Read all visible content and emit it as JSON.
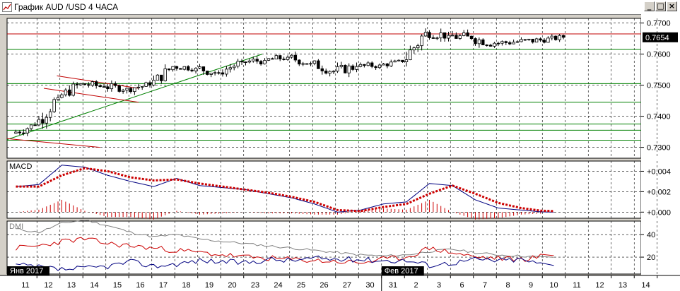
{
  "window": {
    "title": "График AUD /USD  4 ЧАСА",
    "minimize_label": "_",
    "maximize_label": "□",
    "close_label": "×"
  },
  "colors": {
    "background": "#ffffff",
    "grid": "#000000",
    "candle": "#000000",
    "resistance_line": "#c00000",
    "support_lines": "#008000",
    "trend_line": "#008000",
    "macd_line": "#000080",
    "signal_line": "#cc0000",
    "histogram": "#cc0000",
    "adx": "#808080",
    "di_plus": "#cc0000",
    "di_minus": "#000080",
    "price_label_bg": "#000000",
    "price_label_fg": "#ffffff"
  },
  "chart_data": {
    "type": "candlestick",
    "symbol": "AUD/USD",
    "timeframe": "4 ЧАСА",
    "current_price": "0.7654",
    "price_axis_ticks": [
      "0.7700",
      "0.7600",
      "0.7500",
      "0.7400",
      "0.7300"
    ],
    "price_ylim": [
      0.7265,
      0.7715
    ],
    "horizontal_levels": {
      "resistance": [
        0.7665
      ],
      "support": [
        0.7615,
        0.7505,
        0.7445,
        0.7375,
        0.7355,
        0.7323
      ]
    },
    "date_labels": [
      "11",
      "12",
      "13",
      "14",
      "15",
      "16",
      "17",
      "18",
      "19",
      "20",
      "23",
      "24",
      "25",
      "26",
      "27",
      "30",
      "31",
      "2",
      "3",
      "6",
      "7",
      "8",
      "9",
      "10",
      "11",
      "12",
      "13",
      "14"
    ],
    "month_labels": [
      {
        "text": "Янв 2017",
        "date_index": 0
      },
      {
        "text": "Фев 2017",
        "date_index": 16
      }
    ],
    "candles_per_day": 6,
    "daily_ohlc": [
      [
        0.7345,
        0.7385,
        0.732,
        0.7372
      ],
      [
        0.7372,
        0.7475,
        0.736,
        0.746
      ],
      [
        0.746,
        0.753,
        0.745,
        0.7505
      ],
      [
        0.7505,
        0.7525,
        0.747,
        0.7495
      ],
      [
        0.7495,
        0.752,
        0.7465,
        0.749
      ],
      [
        0.749,
        0.7515,
        0.746,
        0.75
      ],
      [
        0.75,
        0.7575,
        0.749,
        0.756
      ],
      [
        0.756,
        0.758,
        0.7535,
        0.7555
      ],
      [
        0.7555,
        0.757,
        0.75,
        0.754
      ],
      [
        0.754,
        0.7585,
        0.7525,
        0.7575
      ],
      [
        0.7575,
        0.7595,
        0.754,
        0.758
      ],
      [
        0.758,
        0.761,
        0.756,
        0.759
      ],
      [
        0.759,
        0.761,
        0.7545,
        0.757
      ],
      [
        0.757,
        0.759,
        0.752,
        0.7545
      ],
      [
        0.7545,
        0.758,
        0.751,
        0.756
      ],
      [
        0.756,
        0.7585,
        0.754,
        0.7565
      ],
      [
        0.7565,
        0.759,
        0.755,
        0.7575
      ],
      [
        0.7575,
        0.769,
        0.756,
        0.767
      ],
      [
        0.767,
        0.771,
        0.764,
        0.766
      ],
      [
        0.766,
        0.7705,
        0.763,
        0.765
      ],
      [
        0.765,
        0.769,
        0.762,
        0.7635
      ],
      [
        0.7635,
        0.7665,
        0.7615,
        0.764
      ],
      [
        0.764,
        0.767,
        0.762,
        0.7645
      ],
      [
        0.7645,
        0.7665,
        0.7625,
        0.7654
      ]
    ],
    "macd": {
      "label": "MACD",
      "axis_ticks": [
        "+0.004",
        "+0.002",
        "+0.000"
      ],
      "ylim": [
        -0.0006,
        0.005
      ],
      "macd_line": [
        0.0025,
        0.0027,
        0.0046,
        0.0044,
        0.0036,
        0.003,
        0.0025,
        0.0033,
        0.0026,
        0.0024,
        0.0022,
        0.0018,
        0.0014,
        0.0008,
        0.0,
        0.0002,
        0.0008,
        0.001,
        0.0028,
        0.0026,
        0.0012,
        0.0004,
        0.0002,
        0.0
      ],
      "signal_line": [
        0.0025,
        0.0025,
        0.0036,
        0.0043,
        0.004,
        0.0034,
        0.0031,
        0.0032,
        0.0028,
        0.0025,
        0.0022,
        0.0019,
        0.0015,
        0.001,
        0.0002,
        0.0001,
        0.0005,
        0.0008,
        0.0018,
        0.0026,
        0.0018,
        0.0009,
        0.0004,
        0.0001
      ]
    },
    "dmi": {
      "label": "DMI",
      "axis_ticks": [
        "40",
        "20"
      ],
      "ylim": [
        5,
        52
      ],
      "adx": [
        45,
        42,
        50,
        53,
        48,
        42,
        38,
        40,
        36,
        34,
        32,
        30,
        28,
        26,
        24,
        22,
        21,
        22,
        25,
        27,
        24,
        22,
        21,
        20
      ],
      "di_plus": [
        28,
        30,
        34,
        36,
        32,
        30,
        28,
        26,
        24,
        22,
        20,
        19,
        18,
        17,
        16,
        15,
        18,
        20,
        28,
        24,
        20,
        19,
        18,
        21
      ],
      "di_minus": [
        13,
        11,
        9,
        10,
        12,
        16,
        12,
        14,
        17,
        16,
        15,
        18,
        17,
        19,
        18,
        18,
        17,
        17,
        13,
        15,
        18,
        17,
        18,
        13
      ]
    }
  }
}
